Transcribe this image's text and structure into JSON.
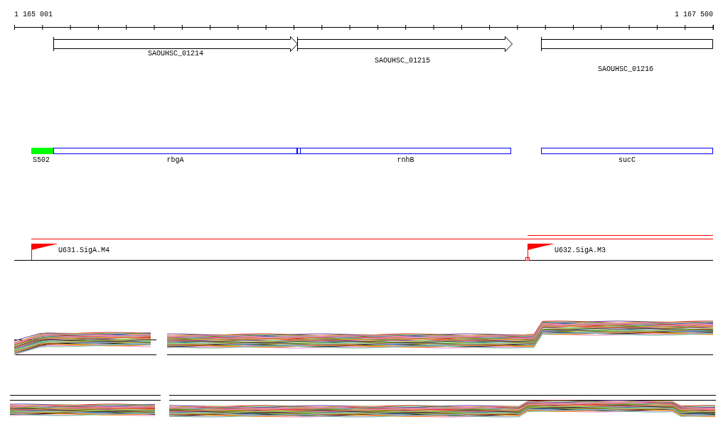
{
  "ruler": {
    "start_label": "1 165 001",
    "end_label": "1 167 500"
  },
  "genes": [
    {
      "label": "SAOUHSC_01214",
      "kind": "arrow"
    },
    {
      "label": "SAOUHSC_01215",
      "kind": "arrow"
    },
    {
      "label": "SAOUHSC_01216",
      "kind": "box"
    }
  ],
  "features": [
    {
      "label": "S502",
      "kind": "filled",
      "color": "#00ff00"
    },
    {
      "label": "rbgA",
      "kind": "outline",
      "color": "#0000ff"
    },
    {
      "label": "rnhB",
      "kind": "outline",
      "color": "#0000ff"
    },
    {
      "label": "sucC",
      "kind": "outline",
      "color": "#0000ff"
    }
  ],
  "promoters": [
    {
      "label": "U631.SigA.M4"
    },
    {
      "label": "U632.SigA.M3"
    }
  ]
}
